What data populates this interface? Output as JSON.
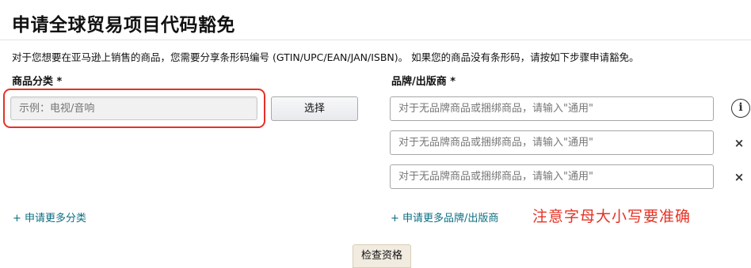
{
  "header": {
    "title": "申请全球贸易项目代码豁免",
    "description": "对于您想要在亚马逊上销售的商品，您需要分享条形码编号 (GTIN/UPC/EAN/JAN/ISBN)。 如果您的商品没有条形码，请按如下步骤申请豁免。"
  },
  "category": {
    "label": "商品分类 *",
    "placeholder": "示例：电视/音响",
    "select_button": "选择",
    "add_more_link": "+ 申请更多分类"
  },
  "brand": {
    "label": "品牌/出版商 *",
    "fields": [
      {
        "placeholder": "对于无品牌商品或捆绑商品，请输入\"通用\""
      },
      {
        "placeholder": "对于无品牌商品或捆绑商品，请输入\"通用\""
      },
      {
        "placeholder": "对于无品牌商品或捆绑商品，请输入\"通用\""
      }
    ],
    "info_icon": "i",
    "remove_icon": "×",
    "add_more_link": "+ 申请更多品牌/出版商"
  },
  "annotation": {
    "note": "注意字母大小写要准确",
    "highlight_color": "#e53225"
  },
  "actions": {
    "check_button": "检查资格"
  },
  "colors": {
    "link": "#0b6e82",
    "annotation_red": "#e53225"
  },
  "icons": {
    "info": "info-icon",
    "remove": "close-icon"
  }
}
